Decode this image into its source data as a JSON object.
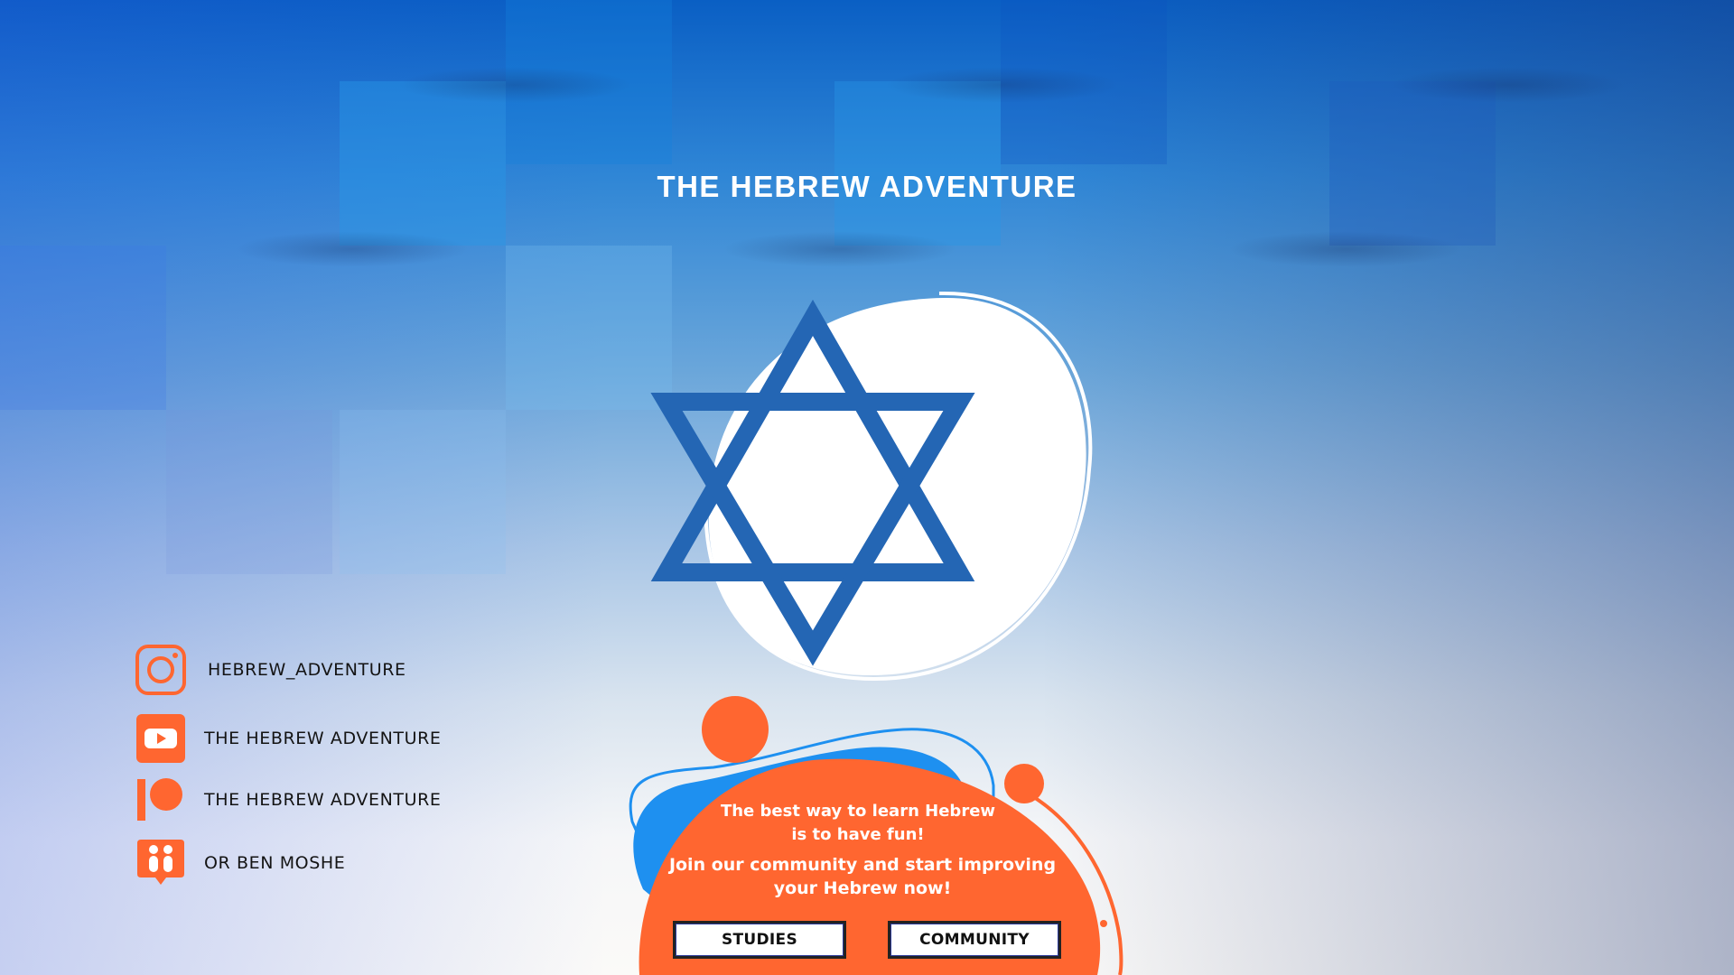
{
  "page": {
    "title": "THE HEBREW ADVENTURE"
  },
  "colors": {
    "brand_orange": "#ff6630",
    "star_blue": "#2466b4",
    "accent_blue": "#1e90f0",
    "white": "#ffffff"
  },
  "hero": {
    "icon": "star-of-david-icon"
  },
  "social": {
    "items": [
      {
        "icon": "instagram-icon",
        "label": "HEBREW_ADVENTURE"
      },
      {
        "icon": "youtube-icon",
        "label": "THE HEBREW ADVENTURE"
      },
      {
        "icon": "patreon-icon",
        "label": "THE HEBREW ADVENTURE"
      },
      {
        "icon": "italki-icon",
        "label": "OR BEN MOSHE"
      }
    ]
  },
  "panel": {
    "tagline_line1": "The best way to learn Hebrew",
    "tagline_line2": "is to have fun!",
    "cta_line1": "Join our community and start improving",
    "cta_line2": "your Hebrew now!",
    "buttons": {
      "studies": "STUDIES",
      "community": "COMMUNITY"
    }
  }
}
